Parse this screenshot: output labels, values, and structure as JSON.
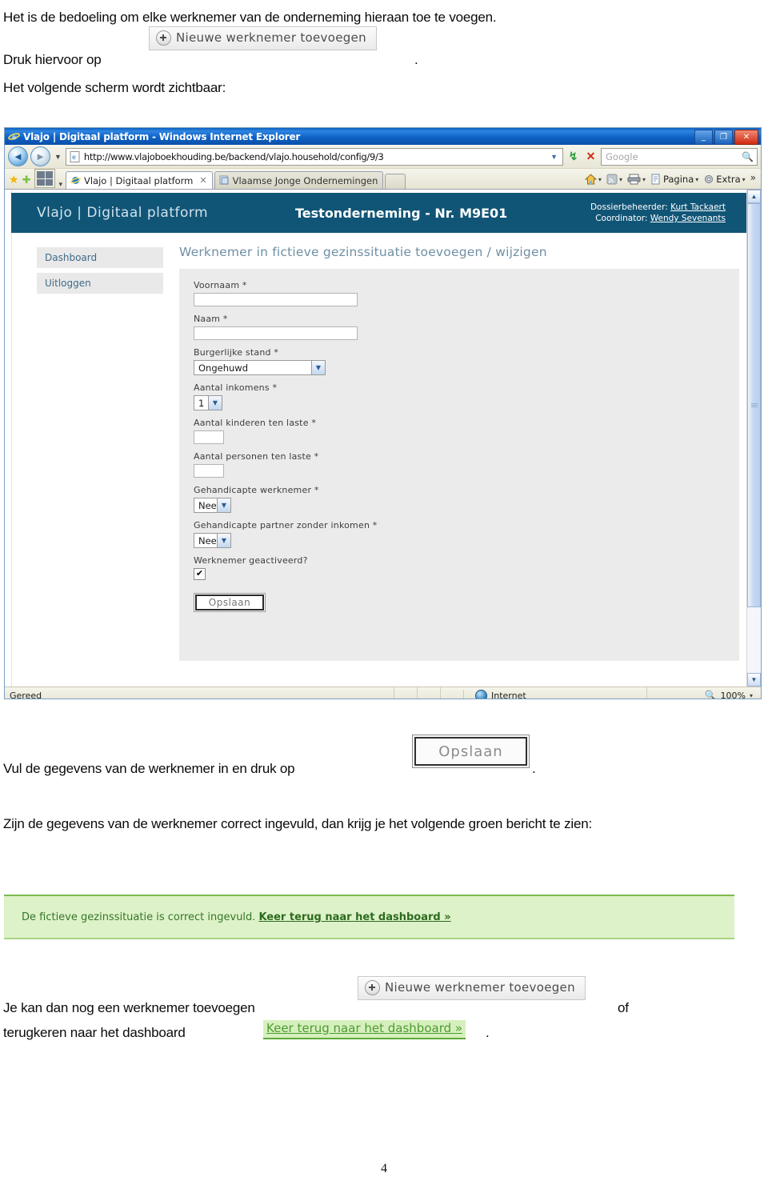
{
  "document": {
    "intro_line": "Het is de bedoeling om elke werknemer van de onderneming hieraan toe te voegen.",
    "druk_prefix": "Druk hiervoor op",
    "period": ".",
    "scherm_line": "Het volgende scherm wordt zichtbaar:",
    "vul_line": "Vul de gegevens van de werknemer in en druk op",
    "zijn_para": "Zijn de gegevens van de werknemer correct ingevuld, dan krijg je het volgende groen bericht te zien:",
    "jekan_prefix": "Je kan dan nog een werknemer toevoegen",
    "of_word": "of",
    "terugkeren_prefix": "terugkeren naar het dashboard",
    "page_number": "4"
  },
  "inline_buttons": {
    "nieuwe_werknemer": "Nieuwe werknemer toevoegen",
    "opslaan": "Opslaan",
    "keer_terug_dashboard": "Keer terug naar het dashboard »"
  },
  "browser": {
    "window_title": "Vlajo | Digitaal platform - Windows Internet Explorer",
    "window_controls": {
      "minimize": "_",
      "maximize": "❐",
      "close": "✕"
    },
    "address_url": "http://www.vlajoboekhouding.be/backend/vlajo.household/config/9/3",
    "search_placeholder": "Google",
    "nav": {
      "back": "◄",
      "forward": "►",
      "history_caret": "▼",
      "refresh": "↯",
      "stop": "✕",
      "address_caret": "▼",
      "search_go": "🔍"
    },
    "tabs": [
      {
        "label": "Vlajo | Digitaal platform",
        "active": true,
        "close": "✕"
      },
      {
        "label": "Vlaamse Jonge Ondernemingen",
        "active": false
      }
    ],
    "command_bar": [
      {
        "label": "",
        "icon": "home-icon",
        "caret": "▾"
      },
      {
        "label": "",
        "icon": "rss-icon",
        "caret": "▾"
      },
      {
        "label": "",
        "icon": "print-icon",
        "caret": "▾"
      },
      {
        "label": "Pagina",
        "icon": "page-icon",
        "caret": "▾"
      },
      {
        "label": "Extra",
        "icon": "gear-icon",
        "caret": "▾"
      }
    ],
    "command_more": "»",
    "status": {
      "ready": "Gereed",
      "zone": "Internet",
      "zoom": "100%",
      "zoom_caret": "▾"
    },
    "scroll": {
      "up": "▲",
      "down": "▼"
    }
  },
  "app": {
    "brand": "Vlajo | Digitaal platform",
    "company": "Testonderneming - Nr. M9E01",
    "meta": {
      "dossier_label": "Dossierbeheerder:",
      "dossier_value": "Kurt Tackaert",
      "coordinator_label": "Coordinator:",
      "coordinator_value": "Wendy Sevenants"
    },
    "sidebar": {
      "items": [
        {
          "label": "Dashboard"
        },
        {
          "label": "Uitloggen"
        }
      ]
    },
    "content": {
      "title": "Werknemer in fictieve gezinssituatie toevoegen / wijzigen",
      "fields": [
        {
          "label": "Voornaam *",
          "type": "text",
          "value": ""
        },
        {
          "label": "Naam *",
          "type": "text",
          "value": ""
        },
        {
          "label": "Burgerlijke stand *",
          "type": "select",
          "value": "Ongehuwd"
        },
        {
          "label": "Aantal inkomens *",
          "type": "select",
          "value": "1"
        },
        {
          "label": "Aantal kinderen ten laste *",
          "type": "text-small",
          "value": ""
        },
        {
          "label": "Aantal personen ten laste *",
          "type": "text-small",
          "value": ""
        },
        {
          "label": "Gehandicapte werknemer *",
          "type": "select",
          "value": "Nee"
        },
        {
          "label": "Gehandicapte partner zonder inkomen *",
          "type": "select",
          "value": "Nee"
        },
        {
          "label": "Werknemer geactiveerd?",
          "type": "checkbox",
          "value": "✔"
        }
      ],
      "save_button": "Opslaan"
    }
  },
  "green_message": {
    "text": "De fictieve gezinssituatie is correct ingevuld.",
    "link": "Keer terug naar het dashboard »"
  },
  "colors": {
    "app_header": "#115576",
    "green_bg": "#ddf2c8",
    "green_border": "#7dba4e",
    "green_text": "#36762a",
    "titlebar_blue": "#0e62c6",
    "sidebar_item": "#e9e9e9",
    "form_panel": "#ebebeb"
  }
}
